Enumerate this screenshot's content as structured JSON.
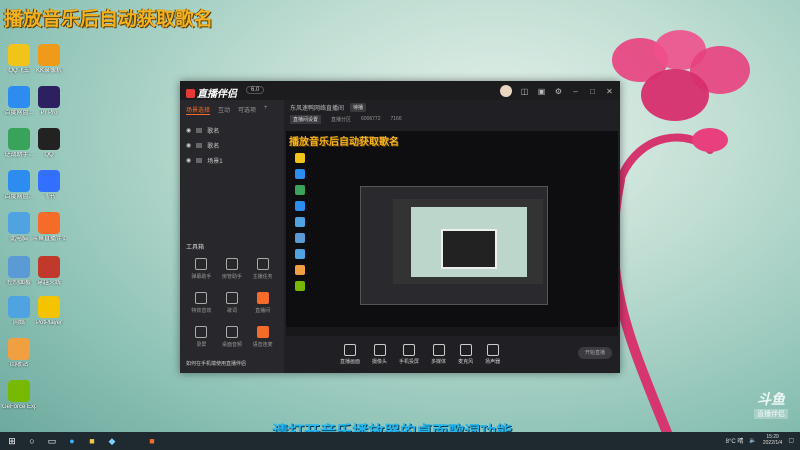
{
  "banner": "播放音乐后自动获取歌名",
  "desktop_icons": [
    {
      "label": "QQ飞车",
      "color": "#f0c419"
    },
    {
      "label": "KK录像机",
      "color": "#f09a19"
    },
    {
      "label": "百度网盘...",
      "color": "#2d8cf0"
    },
    {
      "label": "Pr Pro",
      "color": "#2c2060"
    },
    {
      "label": "逆战助手...",
      "color": "#3aa35b"
    },
    {
      "label": "QQ",
      "color": "#222222"
    },
    {
      "label": "百度网盘...",
      "color": "#2d8cf0"
    },
    {
      "label": "飞书",
      "color": "#3370ff"
    },
    {
      "label": "此电脑",
      "color": "#4fa3e0"
    },
    {
      "label": "斗鱼直播伴侣",
      "color": "#f56c2a"
    },
    {
      "label": "控制面板",
      "color": "#5b9bd5"
    },
    {
      "label": "穿越火线",
      "color": "#c0392b"
    },
    {
      "label": "网络",
      "color": "#4fa3e0"
    },
    {
      "label": "PotPlayer",
      "color": "#f5c400"
    },
    {
      "label": "回收站",
      "color": "#f0a040"
    },
    {
      "label": "GeForce Experience",
      "color": "#76b900"
    }
  ],
  "app": {
    "title": "直播伴侣",
    "version": "6.0",
    "left_tabs": [
      "场景选择",
      "互动",
      "可选项"
    ],
    "scenes": [
      "歌名",
      "歌名",
      "场景1"
    ],
    "toolbox_title": "工具箱",
    "tools": [
      "弹幕助手",
      "房管助手",
      "主播任务",
      "特效音效",
      "歌词",
      "直播间",
      "录屏",
      "桌面音频",
      "语音连麦"
    ],
    "hint": "如何在手机端使用直播伴侣",
    "tab_title": "东风速鸭网络直播间",
    "tab_badge": "待播",
    "info_button": "直播间设置",
    "info_items": [
      "直播分区",
      "6006772",
      "7166"
    ],
    "inner_banner": "播放音乐后自动获取歌名",
    "bottom_buttons": [
      "直播画面",
      "摄像头",
      "手机投屏",
      "多媒体",
      "麦克风",
      "扬声器"
    ],
    "live_button": "开始直播"
  },
  "watermark": {
    "brand": "斗鱼",
    "tag": "直播伴侣"
  },
  "subtitle": "请打开音乐播放器的桌面歌词功能",
  "taskbar": {
    "weather": "8°C 晴",
    "time": "15:29",
    "date": "2022/1/4"
  }
}
